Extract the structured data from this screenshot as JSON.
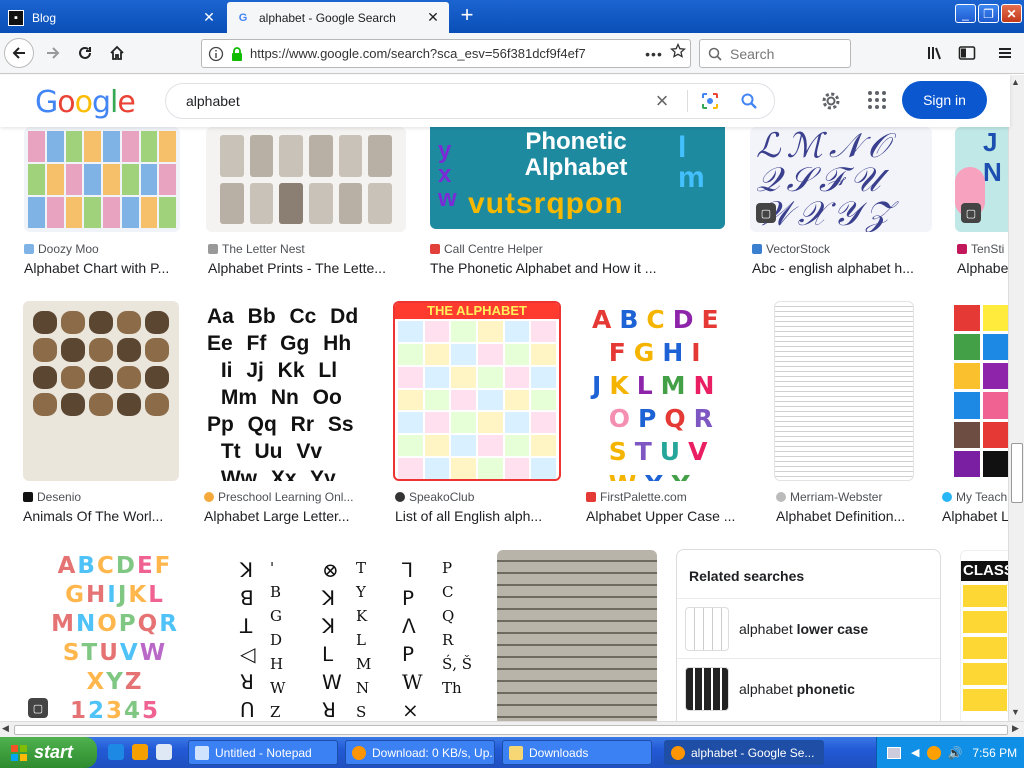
{
  "tabs": [
    {
      "title": "Blog"
    },
    {
      "title": "alphabet - Google Search"
    }
  ],
  "nav": {
    "url": "https://www.google.com/search?sca_esv=56f381dcf9f4ef7",
    "search_placeholder": "Search"
  },
  "google": {
    "query": "alphabet",
    "signin_label": "Sign in"
  },
  "results": [
    {
      "source": "Doozy Moo",
      "title": "Alphabet Chart with P..."
    },
    {
      "source": "The Letter Nest",
      "title": "Alphabet Prints - The Lette..."
    },
    {
      "source": "Call Centre Helper",
      "title": "The Phonetic Alphabet and How it ..."
    },
    {
      "source": "VectorStock",
      "title": "Abc - english alphabet h..."
    },
    {
      "source": "TenSti",
      "title": "Alphabe"
    },
    {
      "source": "Desenio",
      "title": "Animals Of The Worl..."
    },
    {
      "source": "Preschool Learning Onl...",
      "title": "Alphabet Large Letter..."
    },
    {
      "source": "SpeakoClub",
      "title": "List of all English alph..."
    },
    {
      "source": "FirstPalette.com",
      "title": "Alphabet Upper Case ..."
    },
    {
      "source": "Merriam-Webster",
      "title": "Alphabet Definition..."
    },
    {
      "source": "My Teach",
      "title": "Alphabet L"
    }
  ],
  "image_text": {
    "phonetic_line1": "Phonetic",
    "phonetic_line2": "Alphabet",
    "phonetic_letters": "vutsrqpon",
    "the_alphabet": "THE ALPHABET",
    "class": "CLASS"
  },
  "related": {
    "title": "Related searches",
    "items": [
      {
        "prefix": "alphabet ",
        "bold": "lower case"
      },
      {
        "prefix": "alphabet ",
        "bold": "phonetic"
      }
    ]
  },
  "taskbar": {
    "start_label": "start",
    "items": [
      {
        "label": "Untitled - Notepad"
      },
      {
        "label": "Download: 0 KB/s, Up..."
      },
      {
        "label": "Downloads"
      },
      {
        "label": "alphabet - Google Se..."
      }
    ],
    "clock": "7:56 PM"
  },
  "colors": {
    "google_blue": "#4285f4",
    "google_red": "#ea4335",
    "google_yellow": "#fbbc05",
    "google_green": "#34a853",
    "signin_bg": "#0b57d0",
    "taskbar_blue": "#225ad6",
    "start_green": "#3c9c3c"
  },
  "icons": [
    "back-arrow-icon",
    "forward-arrow-icon",
    "reload-icon",
    "home-icon",
    "info-icon",
    "lock-icon",
    "star-icon",
    "search-icon",
    "library-icon",
    "sidebar-icon",
    "menu-icon",
    "close-icon",
    "lens-icon",
    "gear-icon",
    "apps-grid-icon",
    "windows-flag-icon",
    "speaker-icon",
    "clock-icon"
  ]
}
